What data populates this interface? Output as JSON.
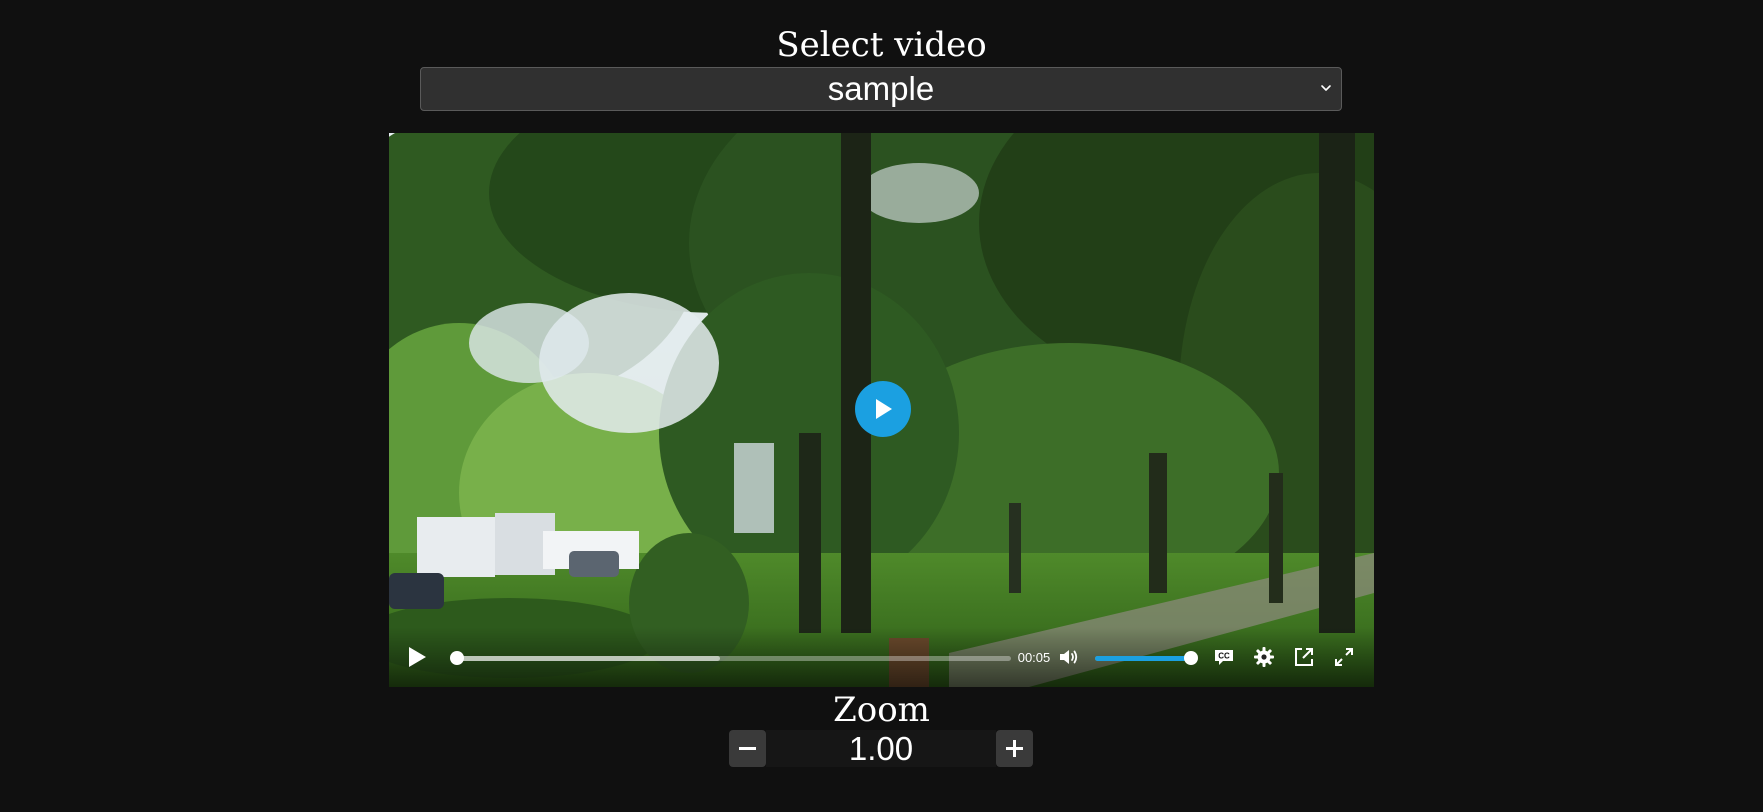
{
  "select": {
    "title": "Select video",
    "value": "sample"
  },
  "player": {
    "play_icon": "play-icon",
    "current_time": "00:05",
    "progress_fraction": 0.01,
    "buffered_fraction": 0.48,
    "volume_fraction": 1.0,
    "accent_color": "#1ba0e1",
    "icons": [
      "play-icon",
      "volume-icon",
      "captions-icon",
      "gear-icon",
      "picture-in-picture-icon",
      "fullscreen-icon"
    ]
  },
  "zoom": {
    "title": "Zoom",
    "value": "1.00",
    "minus_icon": "minus-icon",
    "plus_icon": "plus-icon"
  }
}
